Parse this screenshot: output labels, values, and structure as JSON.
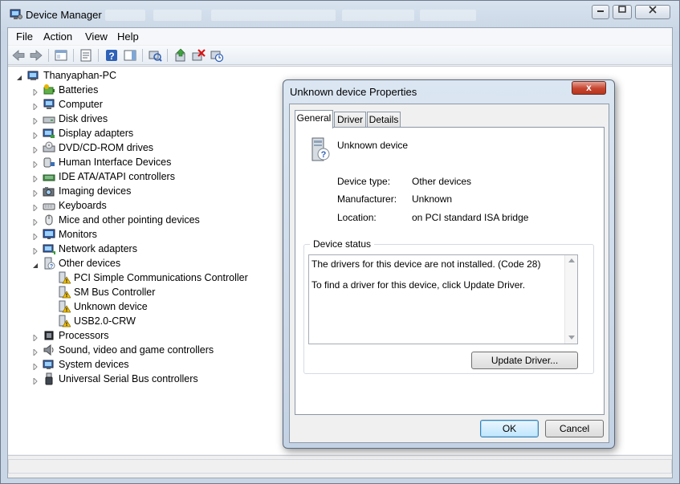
{
  "window": {
    "title": "Device Manager"
  },
  "menu": [
    "File",
    "Action",
    "View",
    "Help"
  ],
  "toolbar": {
    "icons": [
      "back-icon",
      "forward-icon",
      "show-hide-console-tree-icon",
      "properties-icon",
      "help-icon",
      "show-hide-action-pane-icon",
      "scan-hardware-icon",
      "update-driver-icon",
      "uninstall-icon",
      "disable-icon"
    ]
  },
  "tree": {
    "root": "Thanyaphan-PC",
    "categories": [
      {
        "label": "Batteries",
        "icon": "battery-icon",
        "expanded": false
      },
      {
        "label": "Computer",
        "icon": "computer-icon",
        "expanded": false
      },
      {
        "label": "Disk drives",
        "icon": "disk-drive-icon",
        "expanded": false
      },
      {
        "label": "Display adapters",
        "icon": "display-adapter-icon",
        "expanded": false
      },
      {
        "label": "DVD/CD-ROM drives",
        "icon": "dvd-drive-icon",
        "expanded": false
      },
      {
        "label": "Human Interface Devices",
        "icon": "hid-icon",
        "expanded": false
      },
      {
        "label": "IDE ATA/ATAPI controllers",
        "icon": "ide-controller-icon",
        "expanded": false
      },
      {
        "label": "Imaging devices",
        "icon": "camera-icon",
        "expanded": false
      },
      {
        "label": "Keyboards",
        "icon": "keyboard-icon",
        "expanded": false
      },
      {
        "label": "Mice and other pointing devices",
        "icon": "mouse-icon",
        "expanded": false
      },
      {
        "label": "Monitors",
        "icon": "monitor-icon",
        "expanded": false
      },
      {
        "label": "Network adapters",
        "icon": "network-adapter-icon",
        "expanded": false
      },
      {
        "label": "Other devices",
        "icon": "unknown-device-icon",
        "expanded": true,
        "children": [
          "PCI Simple Communications Controller",
          "SM Bus Controller",
          "Unknown device",
          "USB2.0-CRW"
        ]
      },
      {
        "label": "Processors",
        "icon": "processor-icon",
        "expanded": false
      },
      {
        "label": "Sound, video and game controllers",
        "icon": "speaker-icon",
        "expanded": false
      },
      {
        "label": "System devices",
        "icon": "system-device-icon",
        "expanded": false
      },
      {
        "label": "Universal Serial Bus controllers",
        "icon": "usb-icon",
        "expanded": false
      }
    ]
  },
  "dialog": {
    "title": "Unknown device Properties",
    "close_label": "x",
    "tabs": [
      "General",
      "Driver",
      "Details"
    ],
    "active_tab": "General",
    "device_name": "Unknown device",
    "props": [
      {
        "label": "Device type:",
        "value": "Other devices"
      },
      {
        "label": "Manufacturer:",
        "value": "Unknown"
      },
      {
        "label": "Location:",
        "value": "on PCI standard ISA bridge"
      }
    ],
    "status_group_label": "Device status",
    "status_lines": [
      "The drivers for this device are not installed. (Code 28)",
      "To find a driver for this device, click Update Driver."
    ],
    "update_driver_label": "Update Driver...",
    "ok_label": "OK",
    "cancel_label": "Cancel"
  },
  "colors": {
    "warning": "#f2c200",
    "accent": "#3c7fb1"
  }
}
